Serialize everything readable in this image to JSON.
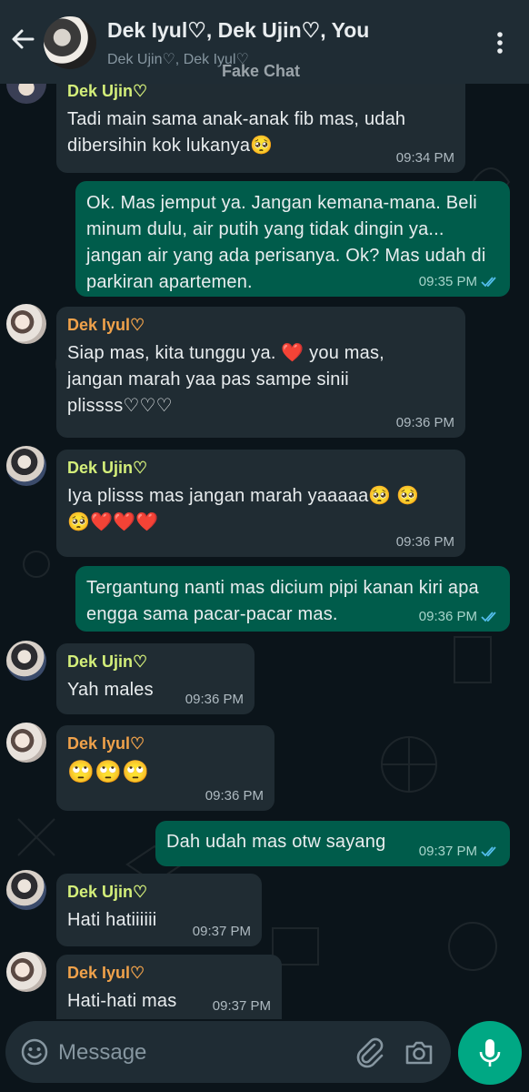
{
  "header": {
    "title": "Dek Iyul♡, Dek Ujin♡, You",
    "subtitle": "Dek Ujin♡, Dek Iyul♡",
    "watermark": "Fake Chat"
  },
  "messages": [
    {
      "sender": "Dek Ujin♡",
      "text": "Tadi main sama anak-anak fib mas, udah dibersihin kok lukanya🥺",
      "time": "09:34 PM"
    },
    {
      "text": "Ok. Mas jemput ya. Jangan kemana-mana. Beli minum dulu, air putih yang tidak dingin ya... jangan air yang ada perisanya. Ok? Mas udah di parkiran apartemen.",
      "time": "09:35 PM"
    },
    {
      "sender": "Dek Iyul♡",
      "text": "Siap mas, kita tunggu ya. ❤️ you mas, jangan marah yaa pas sampe sinii plissss♡♡♡",
      "time": "09:36 PM"
    },
    {
      "sender": "Dek Ujin♡",
      "text": "Iya plisss mas jangan marah yaaaaa🥺 🥺🥺❤️❤️❤️",
      "time": "09:36 PM"
    },
    {
      "text": "Tergantung nanti mas dicium pipi kanan kiri apa engga sama pacar-pacar mas.",
      "time": "09:36 PM"
    },
    {
      "sender": "Dek Ujin♡",
      "text": "Yah males",
      "time": "09:36 PM"
    },
    {
      "sender": "Dek Iyul♡",
      "text": "🙄🙄🙄",
      "time": "09:36 PM"
    },
    {
      "text": "Dah udah mas otw sayang",
      "time": "09:37 PM"
    },
    {
      "sender": "Dek Ujin♡",
      "text": "Hati hatiiiiii",
      "time": "09:37 PM"
    },
    {
      "sender": "Dek Iyul♡",
      "text": "Hati-hati mas",
      "time": "09:37 PM"
    }
  ],
  "input": {
    "placeholder": "Message"
  },
  "colors": {
    "background": "#0b141a",
    "header": "#1f2c34",
    "incoming_bubble": "#202c33",
    "outgoing_bubble": "#005c4b",
    "sender_ujin": "#d4ef7a",
    "sender_iyul": "#f0a24b",
    "mic_button": "#00a884",
    "read_ticks": "#53bdeb"
  }
}
